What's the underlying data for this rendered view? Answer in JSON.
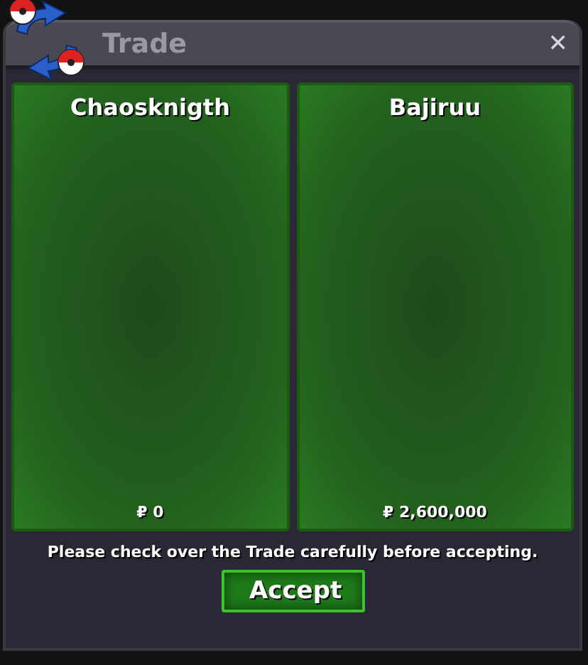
{
  "window": {
    "title": "Trade",
    "close": "✕"
  },
  "offers": [
    {
      "player": "Chaosknigth",
      "money": "₽ 0"
    },
    {
      "player": "Bajiruu",
      "money": "₽ 2,600,000"
    }
  ],
  "note": "Please check over the Trade carefully before accepting.",
  "buttons": [
    "Accept"
  ]
}
